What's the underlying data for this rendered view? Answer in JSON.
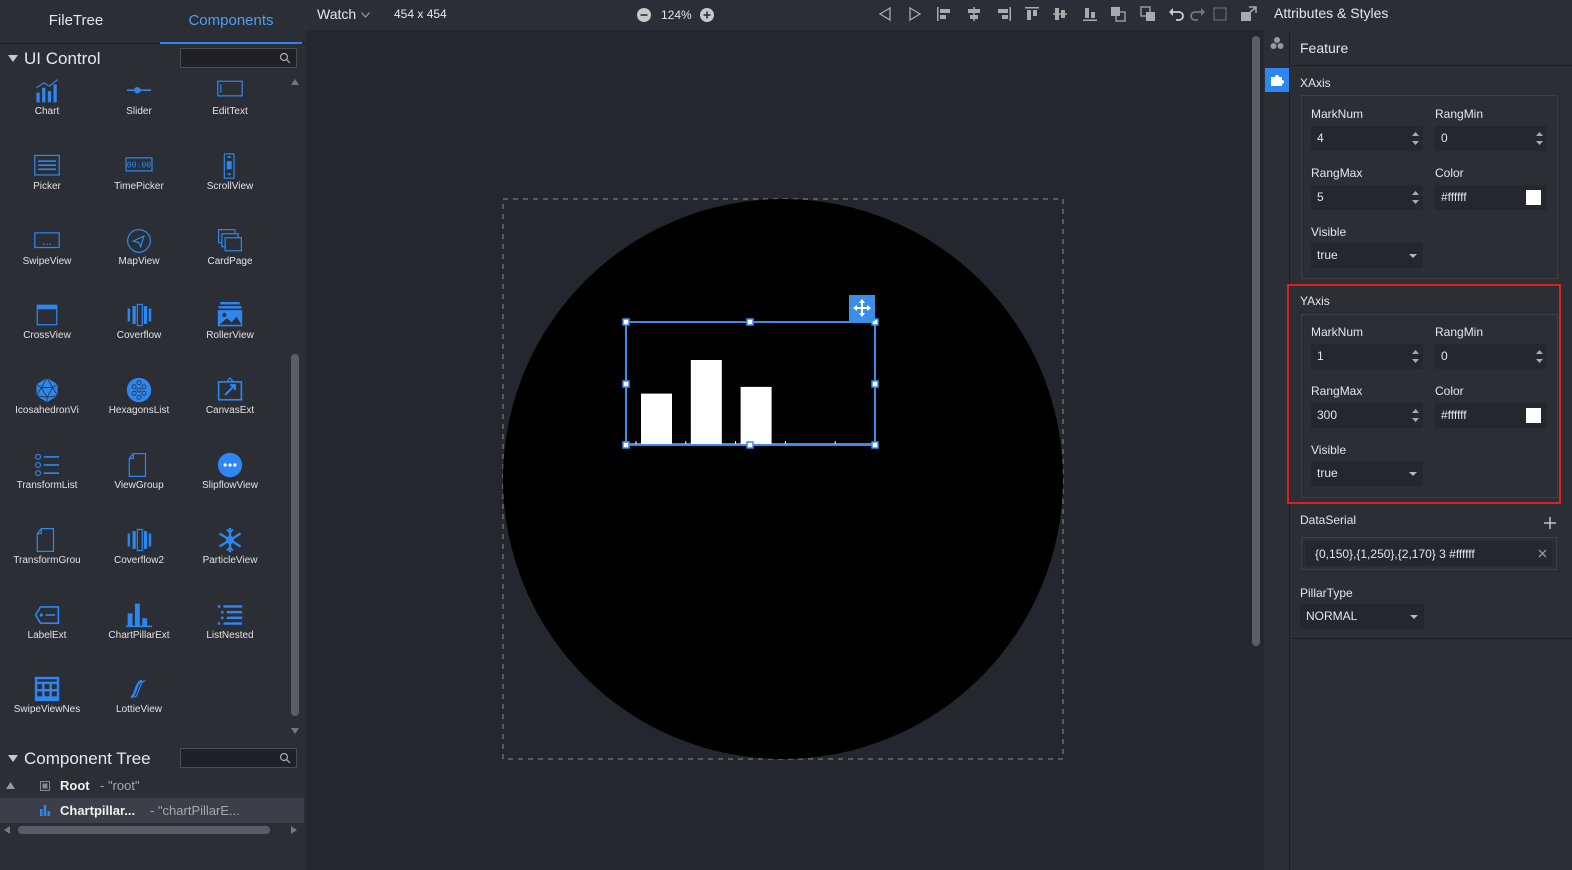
{
  "left_tabs": {
    "filetree": "FileTree",
    "components": "Components"
  },
  "ui_control": {
    "title": "UI Control",
    "items": [
      {
        "label": "Chart",
        "icon": "chart-icon"
      },
      {
        "label": "Slider",
        "icon": "slider-icon"
      },
      {
        "label": "EditText",
        "icon": "edittext-icon"
      },
      {
        "label": "Picker",
        "icon": "picker-icon"
      },
      {
        "label": "TimePicker",
        "icon": "timepicker-icon"
      },
      {
        "label": "ScrollView",
        "icon": "scrollview-icon"
      },
      {
        "label": "SwipeView",
        "icon": "swipeview-icon"
      },
      {
        "label": "MapView",
        "icon": "mapview-icon"
      },
      {
        "label": "CardPage",
        "icon": "cardpage-icon"
      },
      {
        "label": "CrossView",
        "icon": "crossview-icon"
      },
      {
        "label": "Coverflow",
        "icon": "coverflow-icon"
      },
      {
        "label": "RollerView",
        "icon": "rollerview-icon"
      },
      {
        "label": "IcosahedronVi",
        "icon": "icosahedron-icon"
      },
      {
        "label": "HexagonsList",
        "icon": "hexagons-icon"
      },
      {
        "label": "CanvasExt",
        "icon": "canvasext-icon"
      },
      {
        "label": "TransformList",
        "icon": "transformlist-icon"
      },
      {
        "label": "ViewGroup",
        "icon": "viewgroup-icon"
      },
      {
        "label": "SlipflowView",
        "icon": "slipflow-icon"
      },
      {
        "label": "TransformGrou",
        "icon": "transformgroup-icon"
      },
      {
        "label": "Coverflow2",
        "icon": "coverflow2-icon"
      },
      {
        "label": "ParticleView",
        "icon": "particle-icon"
      },
      {
        "label": "LabelExt",
        "icon": "labelext-icon"
      },
      {
        "label": "ChartPillarExt",
        "icon": "chartpillar-icon"
      },
      {
        "label": "ListNested",
        "icon": "listnested-icon"
      },
      {
        "label": "SwipeViewNes",
        "icon": "swipeviewnested-icon"
      },
      {
        "label": "LottieView",
        "icon": "lottie-icon"
      }
    ]
  },
  "component_tree": {
    "title": "Component Tree",
    "rows": [
      {
        "name": "Root",
        "id": "- \"root\""
      },
      {
        "name": "Chartpillar...",
        "id": "- \"chartPillarE..."
      }
    ]
  },
  "toolbar": {
    "device": "Watch",
    "resolution": "454 x 454",
    "zoom": "124%"
  },
  "right_panel": {
    "title": "Attributes & Styles",
    "feature_label": "Feature",
    "xaxis": {
      "title": "XAxis",
      "marknum_label": "MarkNum",
      "marknum": "4",
      "rangmin_label": "RangMin",
      "rangmin": "0",
      "rangmax_label": "RangMax",
      "rangmax": "5",
      "color_label": "Color",
      "color": "#ffffff",
      "visible_label": "Visible",
      "visible": "true"
    },
    "yaxis": {
      "title": "YAxis",
      "marknum_label": "MarkNum",
      "marknum": "1",
      "rangmin_label": "RangMin",
      "rangmin": "0",
      "rangmax_label": "RangMax",
      "rangmax": "300",
      "color_label": "Color",
      "color": "#ffffff",
      "visible_label": "Visible",
      "visible": "true"
    },
    "dataserial": {
      "title": "DataSerial",
      "value": "{0,150},{1,250},{2,170} 3 #ffffff"
    },
    "pillartype": {
      "title": "PillarType",
      "value": "NORMAL"
    }
  },
  "chart_data": {
    "type": "bar",
    "categories": [
      "0",
      "1",
      "2"
    ],
    "values": [
      150,
      250,
      170
    ],
    "xlim": [
      0,
      5
    ],
    "ylim": [
      0,
      300
    ],
    "color": "#ffffff"
  },
  "colors": {
    "accent": "#2e86f0",
    "highlight_border": "#e02020",
    "canvas_bg": "#000000"
  }
}
